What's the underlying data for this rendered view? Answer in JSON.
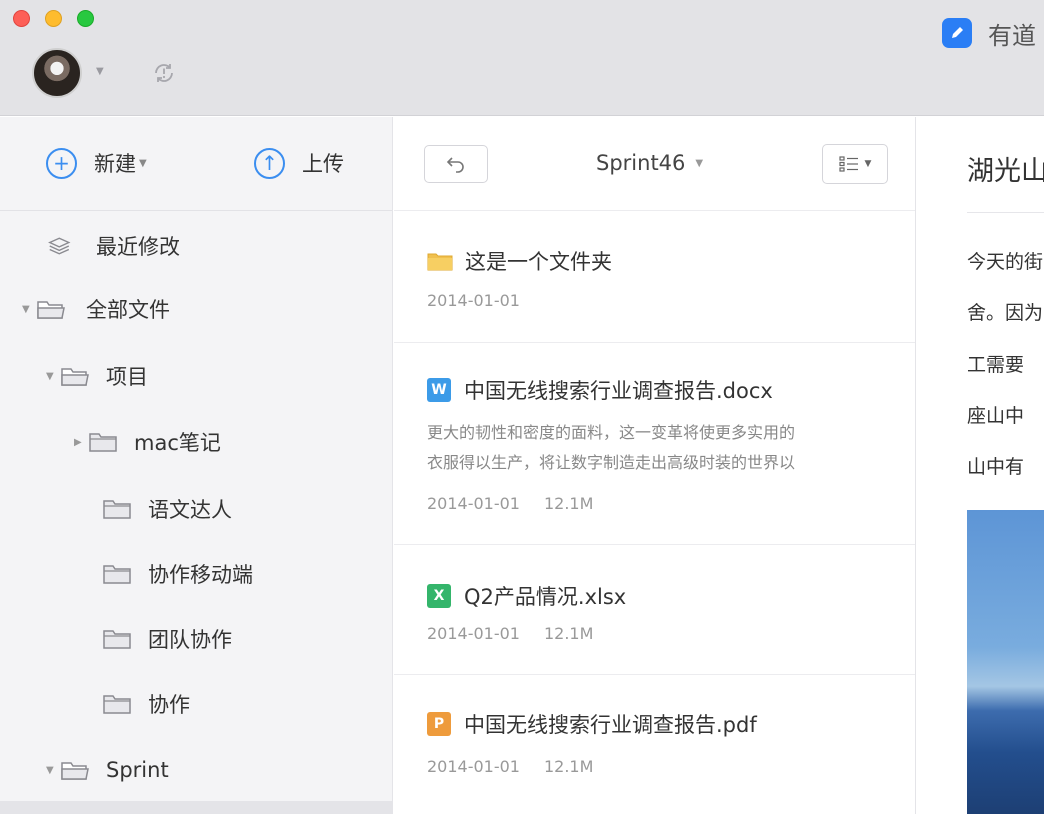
{
  "app": {
    "name": "有道",
    "logo_color": "#2a7ef5"
  },
  "titlebar": {
    "avatar_icon": "user-avatar",
    "sync_icon": "sync-icon"
  },
  "sidebar": {
    "actions": {
      "new_label": "新建",
      "upload_label": "上传"
    },
    "items": [
      {
        "label": "最近修改",
        "icon": "layers-icon"
      },
      {
        "label": "全部文件",
        "icon": "folder-icon",
        "expanded": true
      },
      {
        "label": "项目",
        "icon": "folder-icon",
        "expanded": true
      },
      {
        "label": "mac笔记",
        "icon": "folder-icon",
        "expanded": false
      },
      {
        "label": "语文达人",
        "icon": "folder-icon"
      },
      {
        "label": "协作移动端",
        "icon": "folder-icon"
      },
      {
        "label": "团队协作",
        "icon": "folder-icon"
      },
      {
        "label": "协作",
        "icon": "folder-icon"
      },
      {
        "label": "Sprint",
        "icon": "folder-icon",
        "expanded": true
      }
    ]
  },
  "filelist": {
    "folder_name": "Sprint46",
    "files": [
      {
        "name": "这是一个文件夹",
        "type": "folder",
        "date": "2014-01-01",
        "size": ""
      },
      {
        "name": "中国无线搜索行业调查报告.docx",
        "type": "W",
        "snippet": [
          "更大的韧性和密度的面料，这一变革将使更多实用的",
          "衣服得以生产，将让数字制造走出高级时装的世界以"
        ],
        "date": "2014-01-01",
        "size": "12.1M"
      },
      {
        "name": "Q2产品情况.xlsx",
        "type": "X",
        "date": "2014-01-01",
        "size": "12.1M"
      },
      {
        "name": "中国无线搜索行业调查报告.pdf",
        "type": "P",
        "date": "2014-01-01",
        "size": "12.1M"
      }
    ]
  },
  "preview": {
    "title": "湖光山",
    "lines": [
      "今天的街",
      "舍。因为",
      "工需要",
      "座山中",
      "山中有"
    ]
  }
}
